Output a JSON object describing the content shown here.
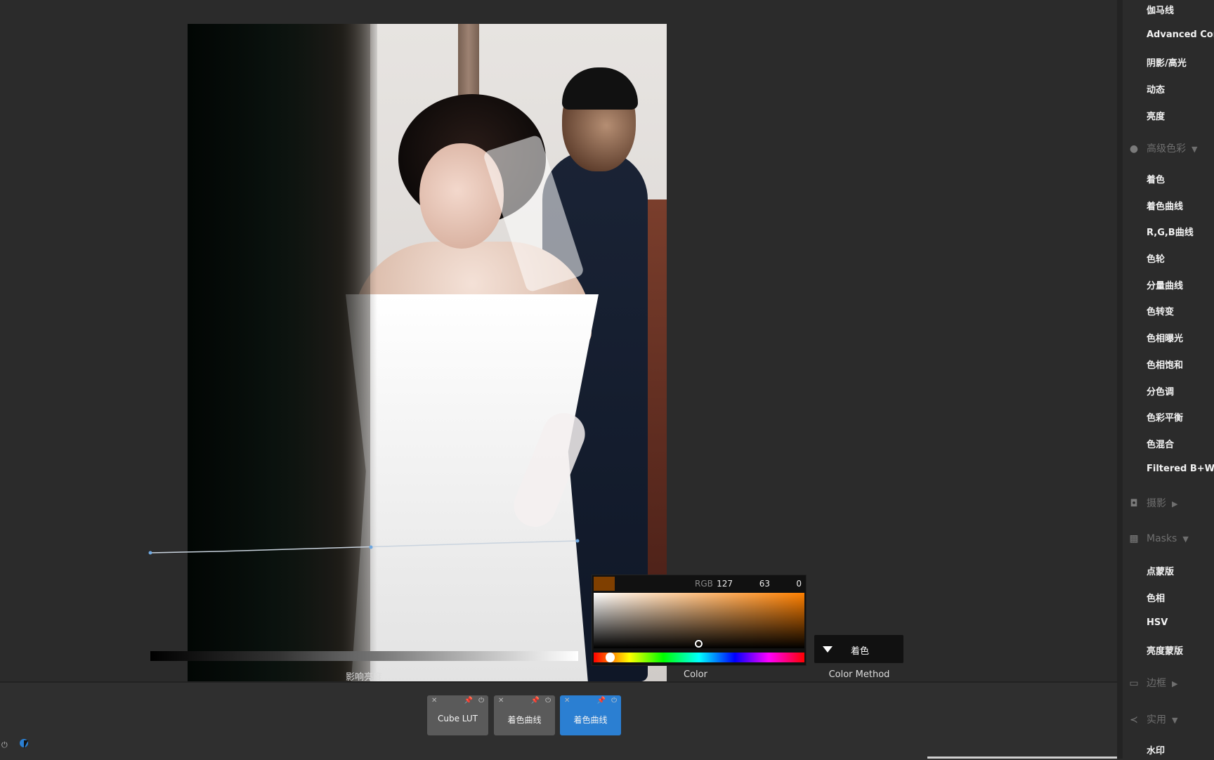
{
  "photo": {
    "alt": ""
  },
  "curve": {
    "label": "影响亮度"
  },
  "color_picker": {
    "swatch_color": "#7f3f00",
    "rgb_label": "RGB",
    "r": "127",
    "g": "63",
    "b": "0",
    "label": "Color"
  },
  "color_method": {
    "value": "着色",
    "label": "Color Method"
  },
  "layers": [
    {
      "name": "Cube LUT",
      "active": false
    },
    {
      "name": "着色曲线",
      "active": false
    },
    {
      "name": "着色曲线",
      "active": true
    }
  ],
  "sidebar": {
    "items_top": [
      "伽马线",
      "Advanced Contrast",
      "阴影/高光",
      "动态",
      "亮度"
    ],
    "section_color": "高级色彩",
    "items_color": [
      "着色",
      "着色曲线",
      "R,G,B曲线",
      "色轮",
      "分量曲线",
      "色转变",
      "色相曝光",
      "色相饱和",
      "分色调",
      "色彩平衡",
      "色混合",
      "Filtered B+W"
    ],
    "section_photo": "摄影",
    "section_masks": "Masks",
    "items_masks": [
      "点蒙版",
      "色相",
      "HSV",
      "亮度蒙版"
    ],
    "section_border": "边框",
    "section_util": "实用",
    "items_util": [
      "水印"
    ]
  },
  "colors": {
    "accent": "#2b7fd2",
    "panel": "#2b2b2b",
    "dark": "#111111"
  }
}
